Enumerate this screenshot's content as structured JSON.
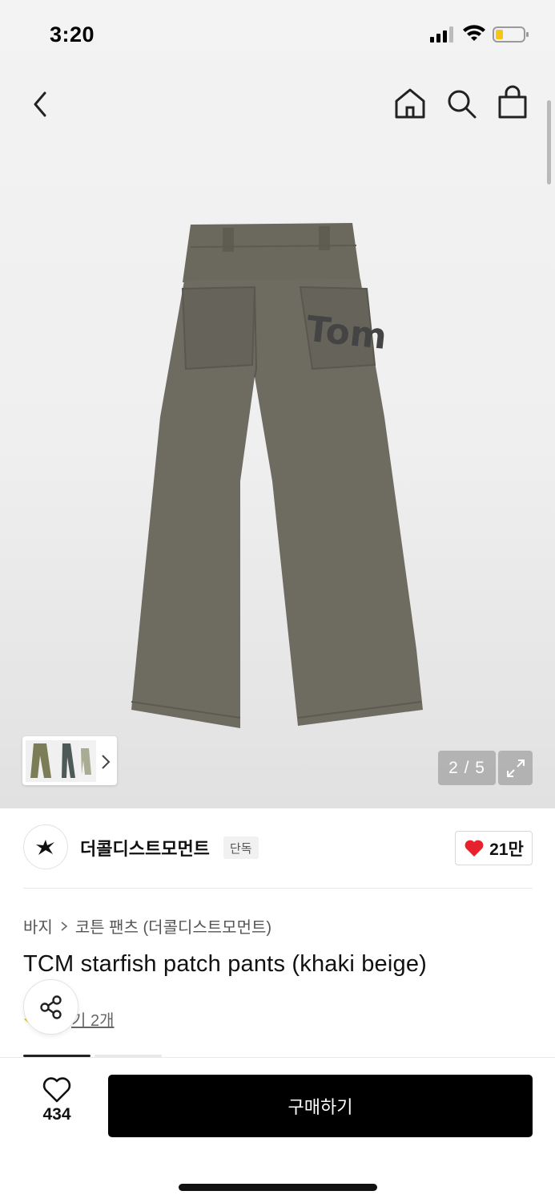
{
  "status_bar": {
    "time": "3:20"
  },
  "gallery": {
    "counter": "2 / 5"
  },
  "brand": {
    "name": "더콜디스트모먼트",
    "badge": "단독",
    "like_count": "21만"
  },
  "product": {
    "breadcrumb": [
      "바지",
      "코튼 팬츠 (더콜디스트모먼트)"
    ],
    "title": "TCM starfish patch pants (khaki beige)",
    "review_link": "후기 2개",
    "review_link_visible": "기 2개"
  },
  "bottom_bar": {
    "wish_count": "434",
    "buy_label": "구매하기"
  },
  "colors": {
    "accent": "#000000",
    "heart": "#e8222c",
    "pants": "#6e6c60"
  },
  "icons": [
    "back-icon",
    "home-icon",
    "search-icon",
    "bag-icon",
    "expand-icon",
    "share-icon",
    "heart-icon",
    "heart-outline-icon",
    "chevron-right-icon"
  ]
}
